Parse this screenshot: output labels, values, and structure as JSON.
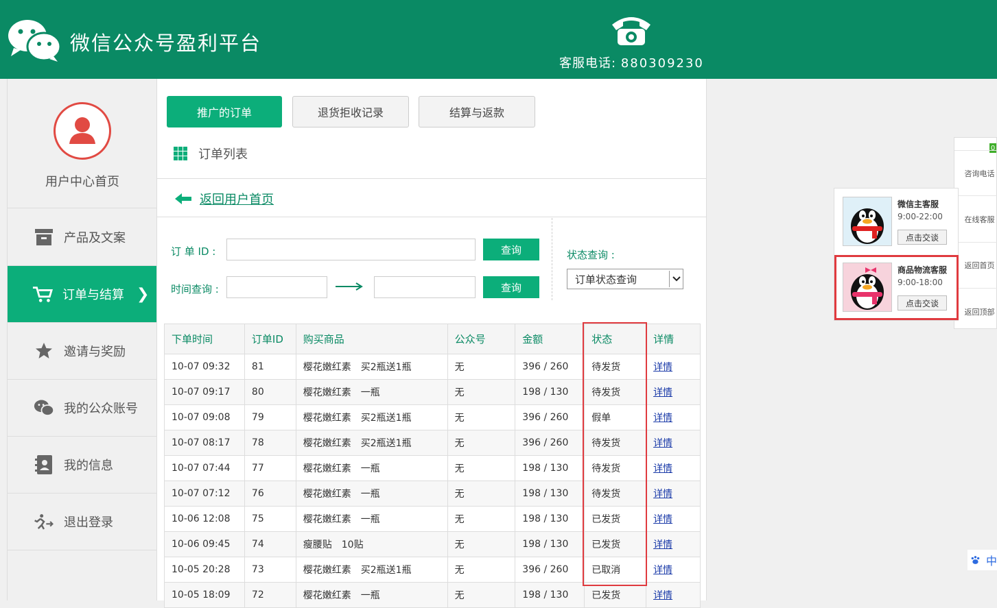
{
  "header": {
    "site_title": "微信公众号盈利平台",
    "hotline_label": "客服电话:",
    "hotline_number": "880309230"
  },
  "sidebar": {
    "user_center": "用户中心首页",
    "items": [
      {
        "label": "产品及文案",
        "icon": "archive-icon"
      },
      {
        "label": "订单与结算",
        "icon": "cart-icon",
        "active": true,
        "arrow": "❯"
      },
      {
        "label": "邀请与奖励",
        "icon": "star-icon"
      },
      {
        "label": "我的公众账号",
        "icon": "wechat-icon"
      },
      {
        "label": "我的信息",
        "icon": "contact-card-icon"
      },
      {
        "label": "退出登录",
        "icon": "run-exit-icon"
      }
    ]
  },
  "tabs": {
    "promoted_orders": "推广的订单",
    "refund_records": "退货拒收记录",
    "settlement": "结算与返款"
  },
  "section": {
    "title": "订单列表"
  },
  "back": {
    "label": "返回用户首页"
  },
  "form": {
    "order_id_label": "订 单 ID :",
    "order_id_value": "",
    "time_label": "时间查询 :",
    "time_start": "",
    "time_end": "",
    "query_button": "查询",
    "status_label": "状态查询 :",
    "status_selected": "订单状态查询"
  },
  "table": {
    "headers": [
      "下单时间",
      "订单ID",
      "购买商品",
      "公众号",
      "金额",
      "状态",
      "详情"
    ],
    "rows": [
      [
        "10-07 09:32",
        "81",
        "樱花嫩红素　买2瓶送1瓶",
        "无",
        "396 / 260",
        "待发货",
        "详情"
      ],
      [
        "10-07 09:17",
        "80",
        "樱花嫩红素　一瓶",
        "无",
        "198 / 130",
        "待发货",
        "详情"
      ],
      [
        "10-07 09:08",
        "79",
        "樱花嫩红素　买2瓶送1瓶",
        "无",
        "396 / 260",
        "假单",
        "详情"
      ],
      [
        "10-07 08:17",
        "78",
        "樱花嫩红素　买2瓶送1瓶",
        "无",
        "396 / 260",
        "待发货",
        "详情"
      ],
      [
        "10-07 07:44",
        "77",
        "樱花嫩红素　一瓶",
        "无",
        "198 / 130",
        "待发货",
        "详情"
      ],
      [
        "10-07 07:12",
        "76",
        "樱花嫩红素　一瓶",
        "无",
        "198 / 130",
        "待发货",
        "详情"
      ],
      [
        "10-06 12:08",
        "75",
        "樱花嫩红素　一瓶",
        "无",
        "198 / 130",
        "已发货",
        "详情"
      ],
      [
        "10-06 09:45",
        "74",
        "瘦腰贴　10贴",
        "无",
        "198 / 130",
        "已发货",
        "详情"
      ],
      [
        "10-05 20:28",
        "73",
        "樱花嫩红素　买2瓶送1瓶",
        "无",
        "396 / 260",
        "已取消",
        "详情"
      ],
      [
        "10-05 18:09",
        "72",
        "樱花嫩红素　一瓶",
        "无",
        "198 / 130",
        "已发货",
        "详情"
      ]
    ]
  },
  "side_tools": {
    "badge": "0",
    "items": [
      "咨询电话",
      "在线客服",
      "返回首页",
      "返回顶部"
    ]
  },
  "support": [
    {
      "name": "微信主客服",
      "hours": "9:00-22:00",
      "chat": "点击交谈"
    },
    {
      "name": "商品物流客服",
      "hours": "9:00-18:00",
      "chat": "点击交谈"
    }
  ],
  "mini_chip": {
    "text": "中"
  },
  "colors": {
    "brand_green": "#0a8a64",
    "accent_green": "#0cae7a",
    "highlight_red": "#e03a3f"
  }
}
